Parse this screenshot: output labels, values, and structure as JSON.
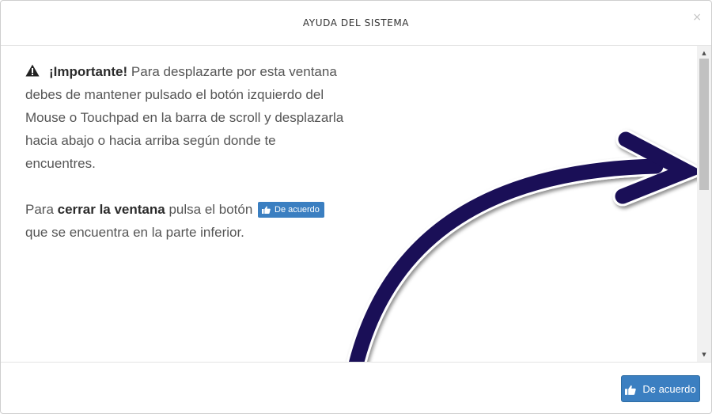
{
  "dialog": {
    "title": "AYUDA DEL SISTEMA",
    "close_symbol": "×"
  },
  "body": {
    "warning_icon": "warning-triangle-icon",
    "important_label": "¡Importante!",
    "paragraph1_text": " Para desplazarte por esta ventana debes de mantener pulsado el botón izquierdo del Mouse o Touchpad en la barra de scroll y desplazarla hacia abajo o hacia arriba según donde te encuentres.",
    "paragraph2_prefix": "Para ",
    "paragraph2_bold": "cerrar la ventana",
    "paragraph2_middle": " pulsa el botón ",
    "inline_button_label": "De acuerdo",
    "paragraph2_suffix": " que se encuentra en la parte inferior.",
    "arrow_color": "#1a0f57"
  },
  "scrollbar": {
    "up_symbol": "▲",
    "down_symbol": "▼",
    "position_fraction": 0.0
  },
  "footer": {
    "confirm_label": "De acuerdo",
    "confirm_icon": "thumbs-up-icon",
    "button_color": "#3b7fc1"
  }
}
